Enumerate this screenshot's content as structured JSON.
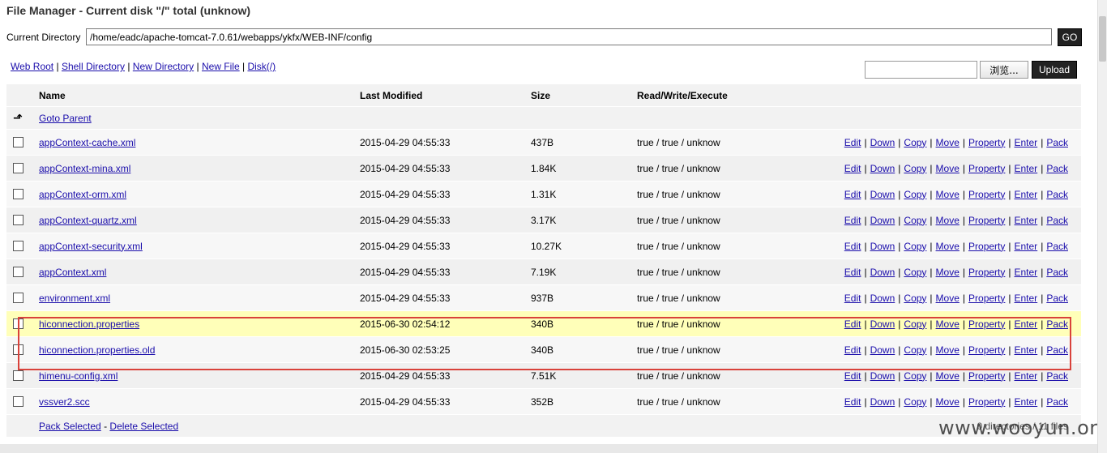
{
  "title": "File Manager - Current disk \"/\" total (unknow)",
  "current_directory": {
    "label": "Current Directory",
    "value": "/home/eadc/apache-tomcat-7.0.61/webapps/ykfx/WEB-INF/config",
    "go_label": "GO"
  },
  "nav": {
    "web_root": "Web Root",
    "shell_directory": "Shell Directory",
    "new_directory": "New Directory",
    "new_file": "New File",
    "disk": "Disk(/)",
    "separator": "|"
  },
  "upload": {
    "browse_label": "浏览...",
    "upload_label": "Upload"
  },
  "table": {
    "headers": {
      "name": "Name",
      "last_modified": "Last Modified",
      "size": "Size",
      "rwe": "Read/Write/Execute"
    },
    "goto_parent": "Goto Parent",
    "actions": [
      "Edit",
      "Down",
      "Copy",
      "Move",
      "Property",
      "Enter",
      "Pack"
    ],
    "files": [
      {
        "name": "appContext-cache.xml",
        "modified": "2015-04-29 04:55:33",
        "size": "437B",
        "rwe": "true / true / unknow"
      },
      {
        "name": "appContext-mina.xml",
        "modified": "2015-04-29 04:55:33",
        "size": "1.84K",
        "rwe": "true / true / unknow"
      },
      {
        "name": "appContext-orm.xml",
        "modified": "2015-04-29 04:55:33",
        "size": "1.31K",
        "rwe": "true / true / unknow"
      },
      {
        "name": "appContext-quartz.xml",
        "modified": "2015-04-29 04:55:33",
        "size": "3.17K",
        "rwe": "true / true / unknow"
      },
      {
        "name": "appContext-security.xml",
        "modified": "2015-04-29 04:55:33",
        "size": "10.27K",
        "rwe": "true / true / unknow"
      },
      {
        "name": "appContext.xml",
        "modified": "2015-04-29 04:55:33",
        "size": "7.19K",
        "rwe": "true / true / unknow"
      },
      {
        "name": "environment.xml",
        "modified": "2015-04-29 04:55:33",
        "size": "937B",
        "rwe": "true / true / unknow"
      },
      {
        "name": "hiconnection.properties",
        "modified": "2015-06-30 02:54:12",
        "size": "340B",
        "rwe": "true / true / unknow"
      },
      {
        "name": "hiconnection.properties.old",
        "modified": "2015-06-30 02:53:25",
        "size": "340B",
        "rwe": "true / true / unknow"
      },
      {
        "name": "himenu-config.xml",
        "modified": "2015-04-29 04:55:33",
        "size": "7.51K",
        "rwe": "true / true / unknow"
      },
      {
        "name": "vssver2.scc",
        "modified": "2015-04-29 04:55:33",
        "size": "352B",
        "rwe": "true / true / unknow"
      }
    ],
    "footer": {
      "pack_selected": "Pack Selected",
      "delete_selected": "Delete Selected",
      "dash": "-",
      "stats": "0 directories / 11 files"
    }
  },
  "watermark": "www.wooyun.org",
  "colors": {
    "highlight_row": "#ffffb9",
    "annotation_box": "#d9423b",
    "link": "#1a0dab"
  },
  "icons": {
    "parent": "up-arrow-icon"
  }
}
